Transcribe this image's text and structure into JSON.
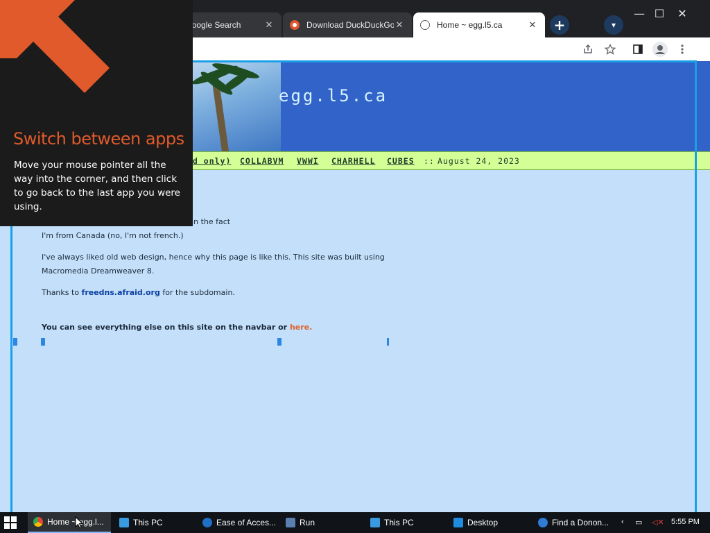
{
  "browser": {
    "tabs": [
      {
        "title": "- Google Search",
        "favicon": "google-icon"
      },
      {
        "title": "Download DuckDuckGo",
        "favicon": "duckduckgo-icon"
      },
      {
        "title": "Home ~ egg.l5.ca",
        "favicon": "globe-icon",
        "active": true
      }
    ],
    "tab_close_glyph": "✕",
    "new_tab_glyph": "+",
    "tab_search_glyph": "▾",
    "window_controls": {
      "minimize": "—",
      "maximize": "☐",
      "close": "✕"
    },
    "toolbar_icons": [
      "share-icon",
      "bookmark-star-icon",
      "side-panel-icon",
      "profile-icon",
      "menu-icon"
    ]
  },
  "site": {
    "title": "egg.l5.ca",
    "nav": {
      "partial_item": "ad only)",
      "items": [
        "COLLABVM",
        "VWWI",
        "CHARHELL",
        "CUBES"
      ],
      "separator": "::",
      "date": "August 24, 2023"
    },
    "content": {
      "line1": "webs. There isn't much to say other than the fact",
      "line2": "I'm from Canada (no, I'm not french.)",
      "para2": "I've always liked old web design, hence why this page is like this. This site was built using Macromedia Dreamweaver 8.",
      "thanks_prefix": "Thanks to",
      "thanks_link": "freedns.afraid.org",
      "thanks_suffix": "for the subdomain.",
      "navbar_note": "You can see everything else on this site on the navbar or",
      "here_link": "here."
    }
  },
  "tip": {
    "heading": "Switch between apps",
    "body": "Move your mouse pointer all the way into the corner, and then click to go back to the last app you were using."
  },
  "taskbar": {
    "items": [
      {
        "label": "Home ~ egg.l...",
        "icon": "chrome-icon",
        "active": true
      },
      {
        "label": "This PC",
        "icon": "computer-icon"
      },
      {
        "label": "Ease of Acces...",
        "icon": "ease-of-access-icon"
      },
      {
        "label": "Run",
        "icon": "run-icon"
      },
      {
        "label": "This PC",
        "icon": "computer-icon"
      },
      {
        "label": "Desktop",
        "icon": "desktop-icon"
      },
      {
        "label": "Find a Donon...",
        "icon": "edge-icon"
      }
    ],
    "clock": "5:55 PM"
  },
  "colors": {
    "accent_frame": "#1aa0e6",
    "banner_blue": "#3263c9",
    "navbar_green": "#d4ff96",
    "page_bg": "#c3dffa",
    "tip_heading": "#e05a2b"
  }
}
